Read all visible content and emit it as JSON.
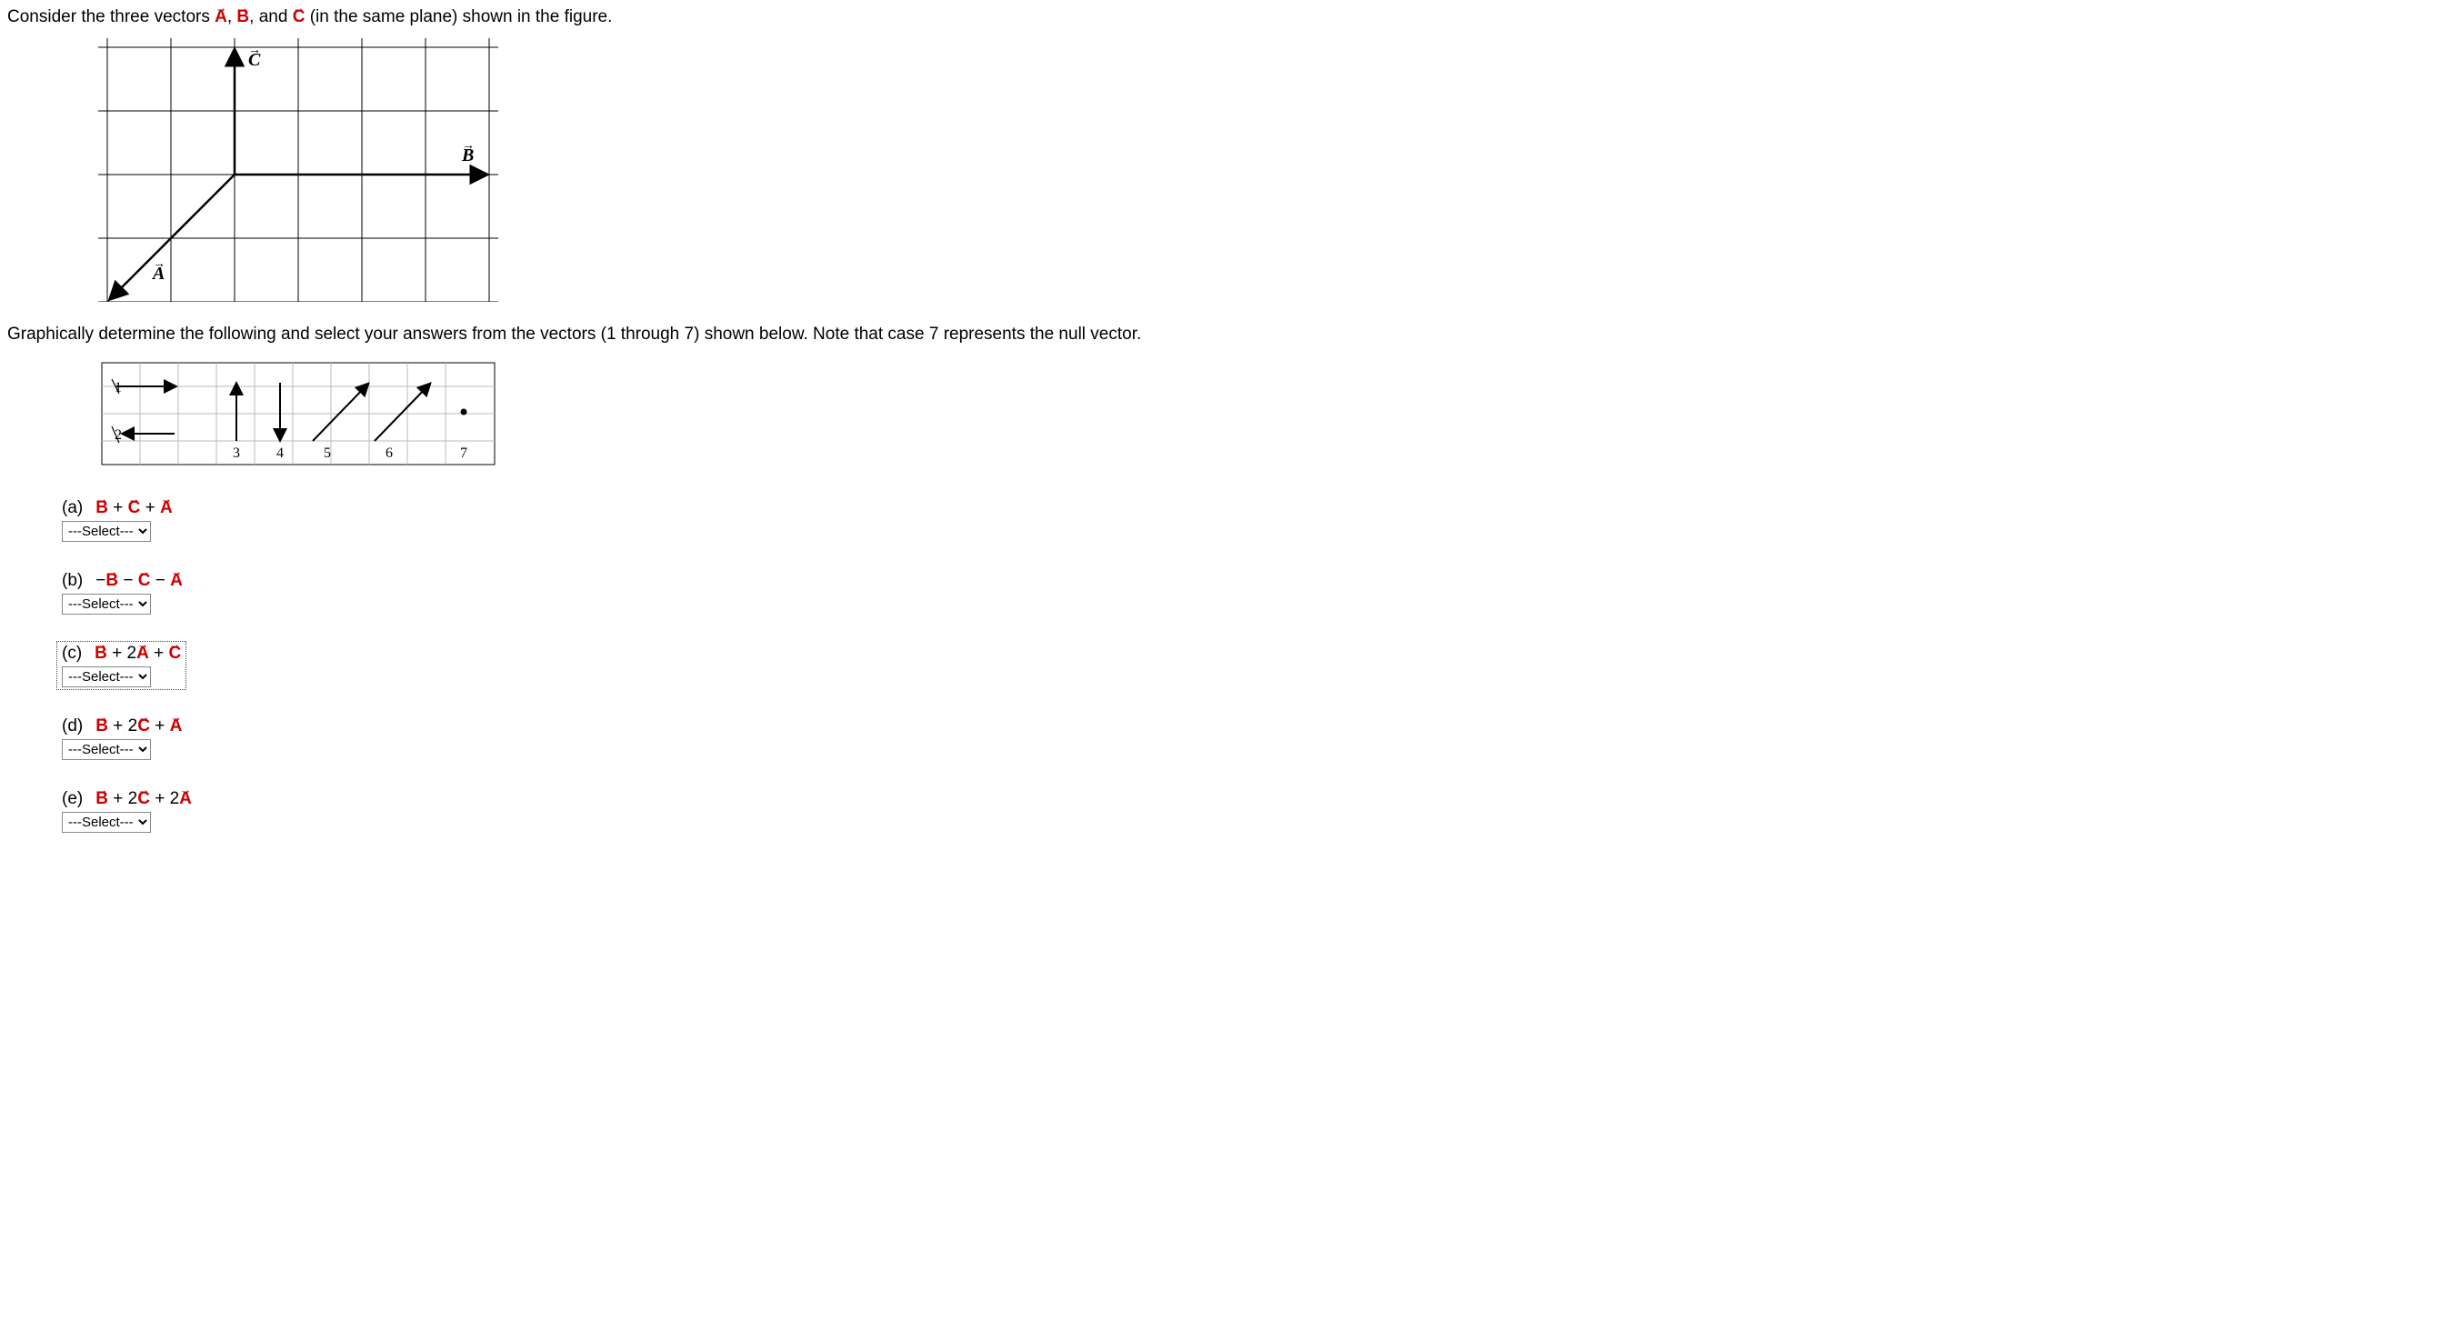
{
  "intro": {
    "prefix": "Consider the three vectors ",
    "vecA": "A",
    "sep1": ", ",
    "vecB": "B",
    "sep2": ", and ",
    "vecC": "C",
    "suffix": " (in the same plane) shown in the figure."
  },
  "instruction": "Graphically determine the following and select your answers from the vectors (1 through 7) shown below. Note that case 7 represents the null vector.",
  "select_placeholder": "---Select---",
  "figure1": {
    "labelA": "A",
    "labelB": "B",
    "labelC": "C"
  },
  "figure2": {
    "labels": [
      "1",
      "2",
      "3",
      "4",
      "5",
      "6",
      "7"
    ]
  },
  "questions": [
    {
      "part": "(a)",
      "tokens": [
        {
          "type": "vec",
          "text": "B"
        },
        {
          "type": "op",
          "text": " + "
        },
        {
          "type": "vec",
          "text": "C"
        },
        {
          "type": "op",
          "text": " + "
        },
        {
          "type": "vec",
          "text": "A"
        }
      ]
    },
    {
      "part": "(b)",
      "tokens": [
        {
          "type": "op",
          "text": "−"
        },
        {
          "type": "vec",
          "text": "B"
        },
        {
          "type": "op",
          "text": " − "
        },
        {
          "type": "vec",
          "text": "C"
        },
        {
          "type": "op",
          "text": " − "
        },
        {
          "type": "vec",
          "text": "A"
        }
      ]
    },
    {
      "part": "(c)",
      "focused": true,
      "tokens": [
        {
          "type": "vec",
          "text": "B"
        },
        {
          "type": "op",
          "text": " + 2"
        },
        {
          "type": "vec",
          "text": "A"
        },
        {
          "type": "op",
          "text": " + "
        },
        {
          "type": "vec",
          "text": "C"
        }
      ]
    },
    {
      "part": "(d)",
      "tokens": [
        {
          "type": "vec",
          "text": "B"
        },
        {
          "type": "op",
          "text": " + 2"
        },
        {
          "type": "vec",
          "text": "C"
        },
        {
          "type": "op",
          "text": " + "
        },
        {
          "type": "vec",
          "text": "A"
        }
      ]
    },
    {
      "part": "(e)",
      "tokens": [
        {
          "type": "vec",
          "text": "B"
        },
        {
          "type": "op",
          "text": " + 2"
        },
        {
          "type": "vec",
          "text": "C"
        },
        {
          "type": "op",
          "text": " + 2"
        },
        {
          "type": "vec",
          "text": "A"
        }
      ]
    }
  ]
}
